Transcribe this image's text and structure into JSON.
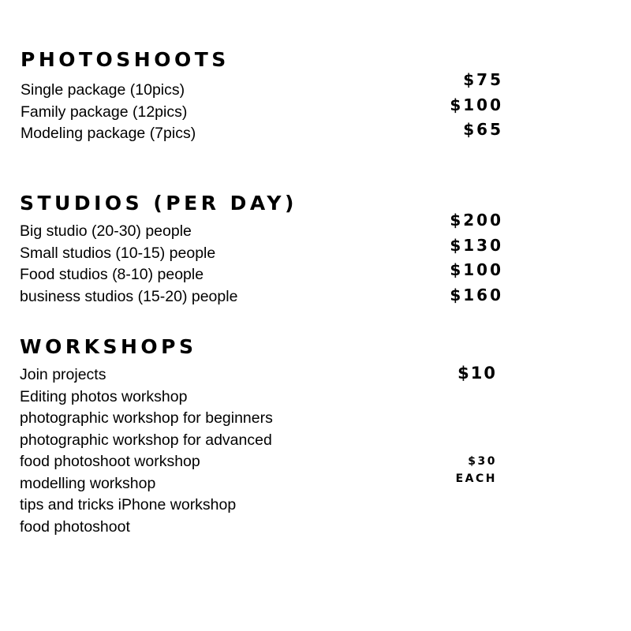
{
  "photoshoots": {
    "title": "PHOTOSHOOTS",
    "items": [
      "Single package (10pics)",
      "Family package (12pics)",
      "Modeling package (7pics)"
    ],
    "prices": [
      "$75",
      "$100",
      "$65"
    ]
  },
  "studios": {
    "title": "STUDIOS (PER DAY)",
    "items": [
      "Big studio (20-30) people",
      "Small studios (10-15) people",
      "Food studios (8-10) people",
      "business studios (15-20) people"
    ],
    "prices": [
      "$200",
      "$130",
      "$100",
      "$160"
    ]
  },
  "workshops": {
    "title": "WORKSHOPS",
    "items": [
      "Join projects",
      "Editing photos workshop",
      "photographic workshop for beginners",
      "photographic workshop for advanced",
      "food photoshoot workshop",
      "modelling workshop",
      "tips and tricks iPhone workshop",
      "food photoshoot"
    ],
    "join_price": "$10",
    "each_price": "$30",
    "each_label": "EACH"
  }
}
